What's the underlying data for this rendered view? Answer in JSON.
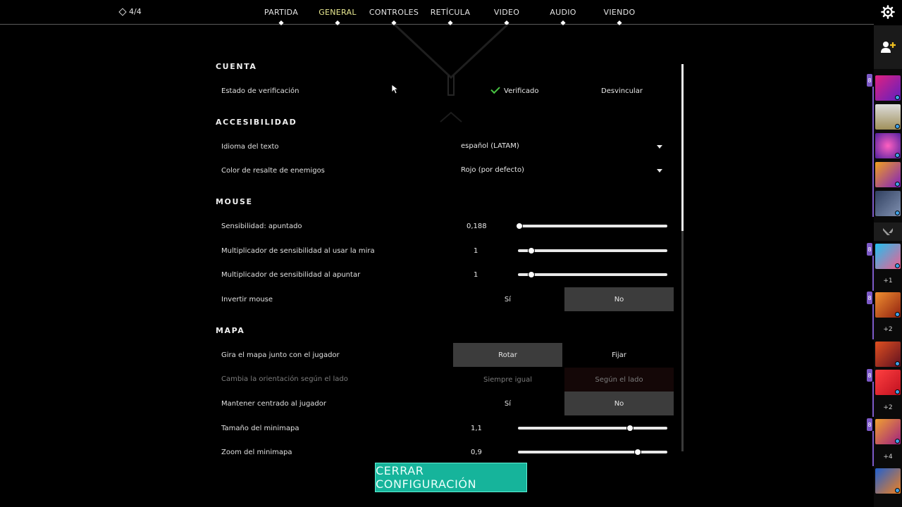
{
  "party": {
    "count": "4/4",
    "icon": "party-diamond-icon"
  },
  "nav": {
    "tabs": [
      {
        "label": "PARTIDA"
      },
      {
        "label": "GENERAL",
        "active": true
      },
      {
        "label": "CONTROLES"
      },
      {
        "label": "RETÍCULA"
      },
      {
        "label": "VIDEO"
      },
      {
        "label": "AUDIO"
      },
      {
        "label": "VIENDO"
      }
    ],
    "active_color": "#eaea92",
    "settings_icon": "gear-icon"
  },
  "sections": {
    "cuenta": "CUENTA",
    "accesibilidad": "ACCESIBILIDAD",
    "mouse": "MOUSE",
    "mapa": "MAPA"
  },
  "rows": {
    "verification": {
      "label": "Estado de verificación",
      "status": "Verificado",
      "action": "Desvincular",
      "status_color": "#49c443"
    },
    "text_language": {
      "label": "Idioma del texto",
      "value": "español (LATAM)"
    },
    "enemy_color": {
      "label": "Color de resalte de enemigos",
      "value": "Rojo (por defecto)"
    },
    "sensitivity": {
      "label": "Sensibilidad: apuntado",
      "value": "0,188",
      "level": 0.01
    },
    "scope_multiplier": {
      "label": "Multiplicador de sensibilidad al usar la mira",
      "value": "1",
      "level": 0.09
    },
    "ads_multiplier": {
      "label": "Multiplicador de sensibilidad al apuntar",
      "value": "1",
      "level": 0.09
    },
    "invert_mouse": {
      "label": "Invertir mouse",
      "option_a": "Sí",
      "option_b": "No",
      "selected": "No"
    },
    "rotate_map": {
      "label": "Gira el mapa junto con el jugador",
      "option_a": "Rotar",
      "option_b": "Fijar",
      "selected": "Rotar"
    },
    "orientation": {
      "label": "Cambia la orientación según el lado",
      "option_a": "Siempre igual",
      "option_b": "Según el lado",
      "selected": "Según el lado",
      "disabled": true
    },
    "keep_centered": {
      "label": "Mantener centrado al jugador",
      "option_a": "Sí",
      "option_b": "No",
      "selected": "No"
    },
    "minimap_size": {
      "label": "Tamaño del minimapa",
      "value": "1,1",
      "level": 0.75
    },
    "minimap_zoom": {
      "label": "Zoom del minimapa",
      "value": "0,9",
      "level": 0.8
    }
  },
  "close_button": {
    "label": "CERRAR CONFIGURACIÓN",
    "color": "#16b49b"
  },
  "social": {
    "add_friend_icon": "add-friend-icon",
    "groups": [
      {
        "badge": "8",
        "more": ""
      },
      {
        "badge": "8",
        "more": "+1"
      },
      {
        "badge": "8",
        "more": "+2"
      },
      {
        "badge": "8",
        "more": "+2"
      },
      {
        "badge": "8",
        "more": "+4"
      }
    ],
    "group_color": "#7d5ac8"
  }
}
